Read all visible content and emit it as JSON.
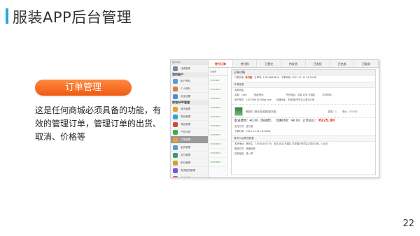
{
  "slide": {
    "title": "服装APP后台管理",
    "pill_label": "订单管理",
    "description": [
      "这是任何商城必须具备的功能，有",
      "效的管理订单，管理订单的出货、",
      "取消、价格等"
    ],
    "page_number": "22",
    "accent_color": "#2ba6d9",
    "pill_color": "#f26a1b"
  },
  "screenshot": {
    "sidebar": {
      "top_text": "用户中心",
      "items": [
        {
          "label": "注销登录",
          "icon": "avatar-icon",
          "color": "#7a8a9a"
        },
        {
          "label": "我的账户",
          "section": true
        },
        {
          "label": "帐户资料",
          "icon": "user-icon",
          "color": "#5a9bd5"
        },
        {
          "label": "个人资料",
          "icon": "profile-icon",
          "color": "#e07a3a"
        },
        {
          "label": "安全设置",
          "icon": "lock-icon",
          "color": "#4a8fd0"
        },
        {
          "label": "商城APP管理",
          "section": true
        },
        {
          "label": "首页管理",
          "icon": "home-icon",
          "color": "#e0a030"
        },
        {
          "label": "类目管理",
          "icon": "category-icon",
          "color": "#3a9fd5"
        },
        {
          "label": "商品管理",
          "icon": "goods-icon",
          "color": "#d04a3a"
        },
        {
          "label": "产品分类",
          "icon": "tag-icon",
          "color": "#4aa84a"
        },
        {
          "label": "订单管理",
          "icon": "order-icon",
          "color": "#f0a030",
          "active": true
        },
        {
          "label": "会员管理",
          "icon": "member-icon",
          "color": "#5a9bd5"
        },
        {
          "label": "支付管理",
          "icon": "payment-icon",
          "color": "#3a9a6a"
        },
        {
          "label": "积分管理",
          "icon": "points-icon",
          "color": "#d0a030"
        },
        {
          "label": "物流配送管理",
          "icon": "delivery-icon",
          "color": "#7a5ad0"
        },
        {
          "label": "统计报表",
          "icon": "chart-icon",
          "color": "#d05a8a"
        }
      ]
    },
    "tabs": [
      {
        "label": "待付订单",
        "active": true
      },
      {
        "label": "待付款"
      },
      {
        "label": "已提交"
      },
      {
        "label": "待发货"
      },
      {
        "label": "已发货"
      },
      {
        "label": "已完成"
      },
      {
        "label": "已取消"
      }
    ],
    "order_list": {
      "header": "订单号",
      "rows": [
        "1311868",
        "13218512",
        "13218613",
        "13218614",
        "13218615",
        "13218616",
        "13218617",
        "13218618",
        "13218619",
        "13218620"
      ]
    },
    "detail": {
      "title": "订单详情",
      "status_line": {
        "status_label": "订单状态:",
        "status_value": "待付款",
        "order_label": "订单号:",
        "order_value": "13218863826",
        "time_label": "下单时间:",
        "time_value": "2013-11-15 16:16:08"
      },
      "section_order": "订单信息",
      "buyer_name": "买家信息",
      "buyer_lines": [
        "买家：yxsh　　　电话号码：　　　　　　　　　所在地区：北京 北京 东城区　　　手机号码：",
        "电子邮件：1037369197@qq.com　　详细地址：东校园4号学生公寓503室"
      ],
      "product": {
        "name": "美图衣（蕾丝真丝翻领连衣裙）",
        "qty": "数量：1",
        "price": "单价：225.00"
      },
      "price_line": {
        "ship_label": "配送费用：¥0.00（免邮费）",
        "discount_label": "优惠打折：¥0.00",
        "total_label": "订单总价：",
        "total_value": "¥225.00"
      },
      "pay_lines": [
        "支付方式：支付宝",
        "下单时间：2013-11-15 16:16:08"
      ],
      "section_recv": "收货人及物流信息",
      "recv_lines": [
        "收货地址：杨先生　18500440778　北京 北京 东城区 东校园4号学生公寓503室，10003",
        "配送方式：快递包邮",
        "买家留言：给一带"
      ]
    }
  }
}
